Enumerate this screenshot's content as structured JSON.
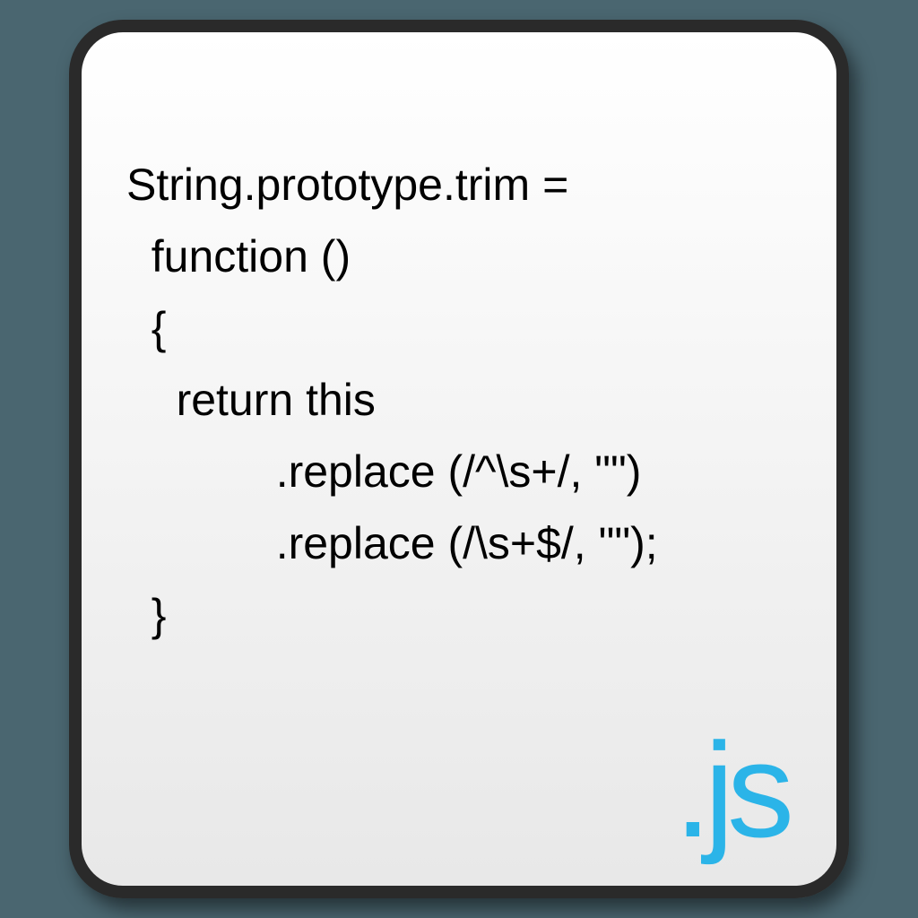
{
  "code": {
    "line1": "String.prototype.trim =",
    "line2": "  function ()",
    "line3": "  {",
    "line4": "    return this",
    "line5": "            .replace (/^\\s+/, \"\")",
    "line6": "            .replace (/\\s+$/, \"\");",
    "line7": "  }"
  },
  "extension": ".js"
}
